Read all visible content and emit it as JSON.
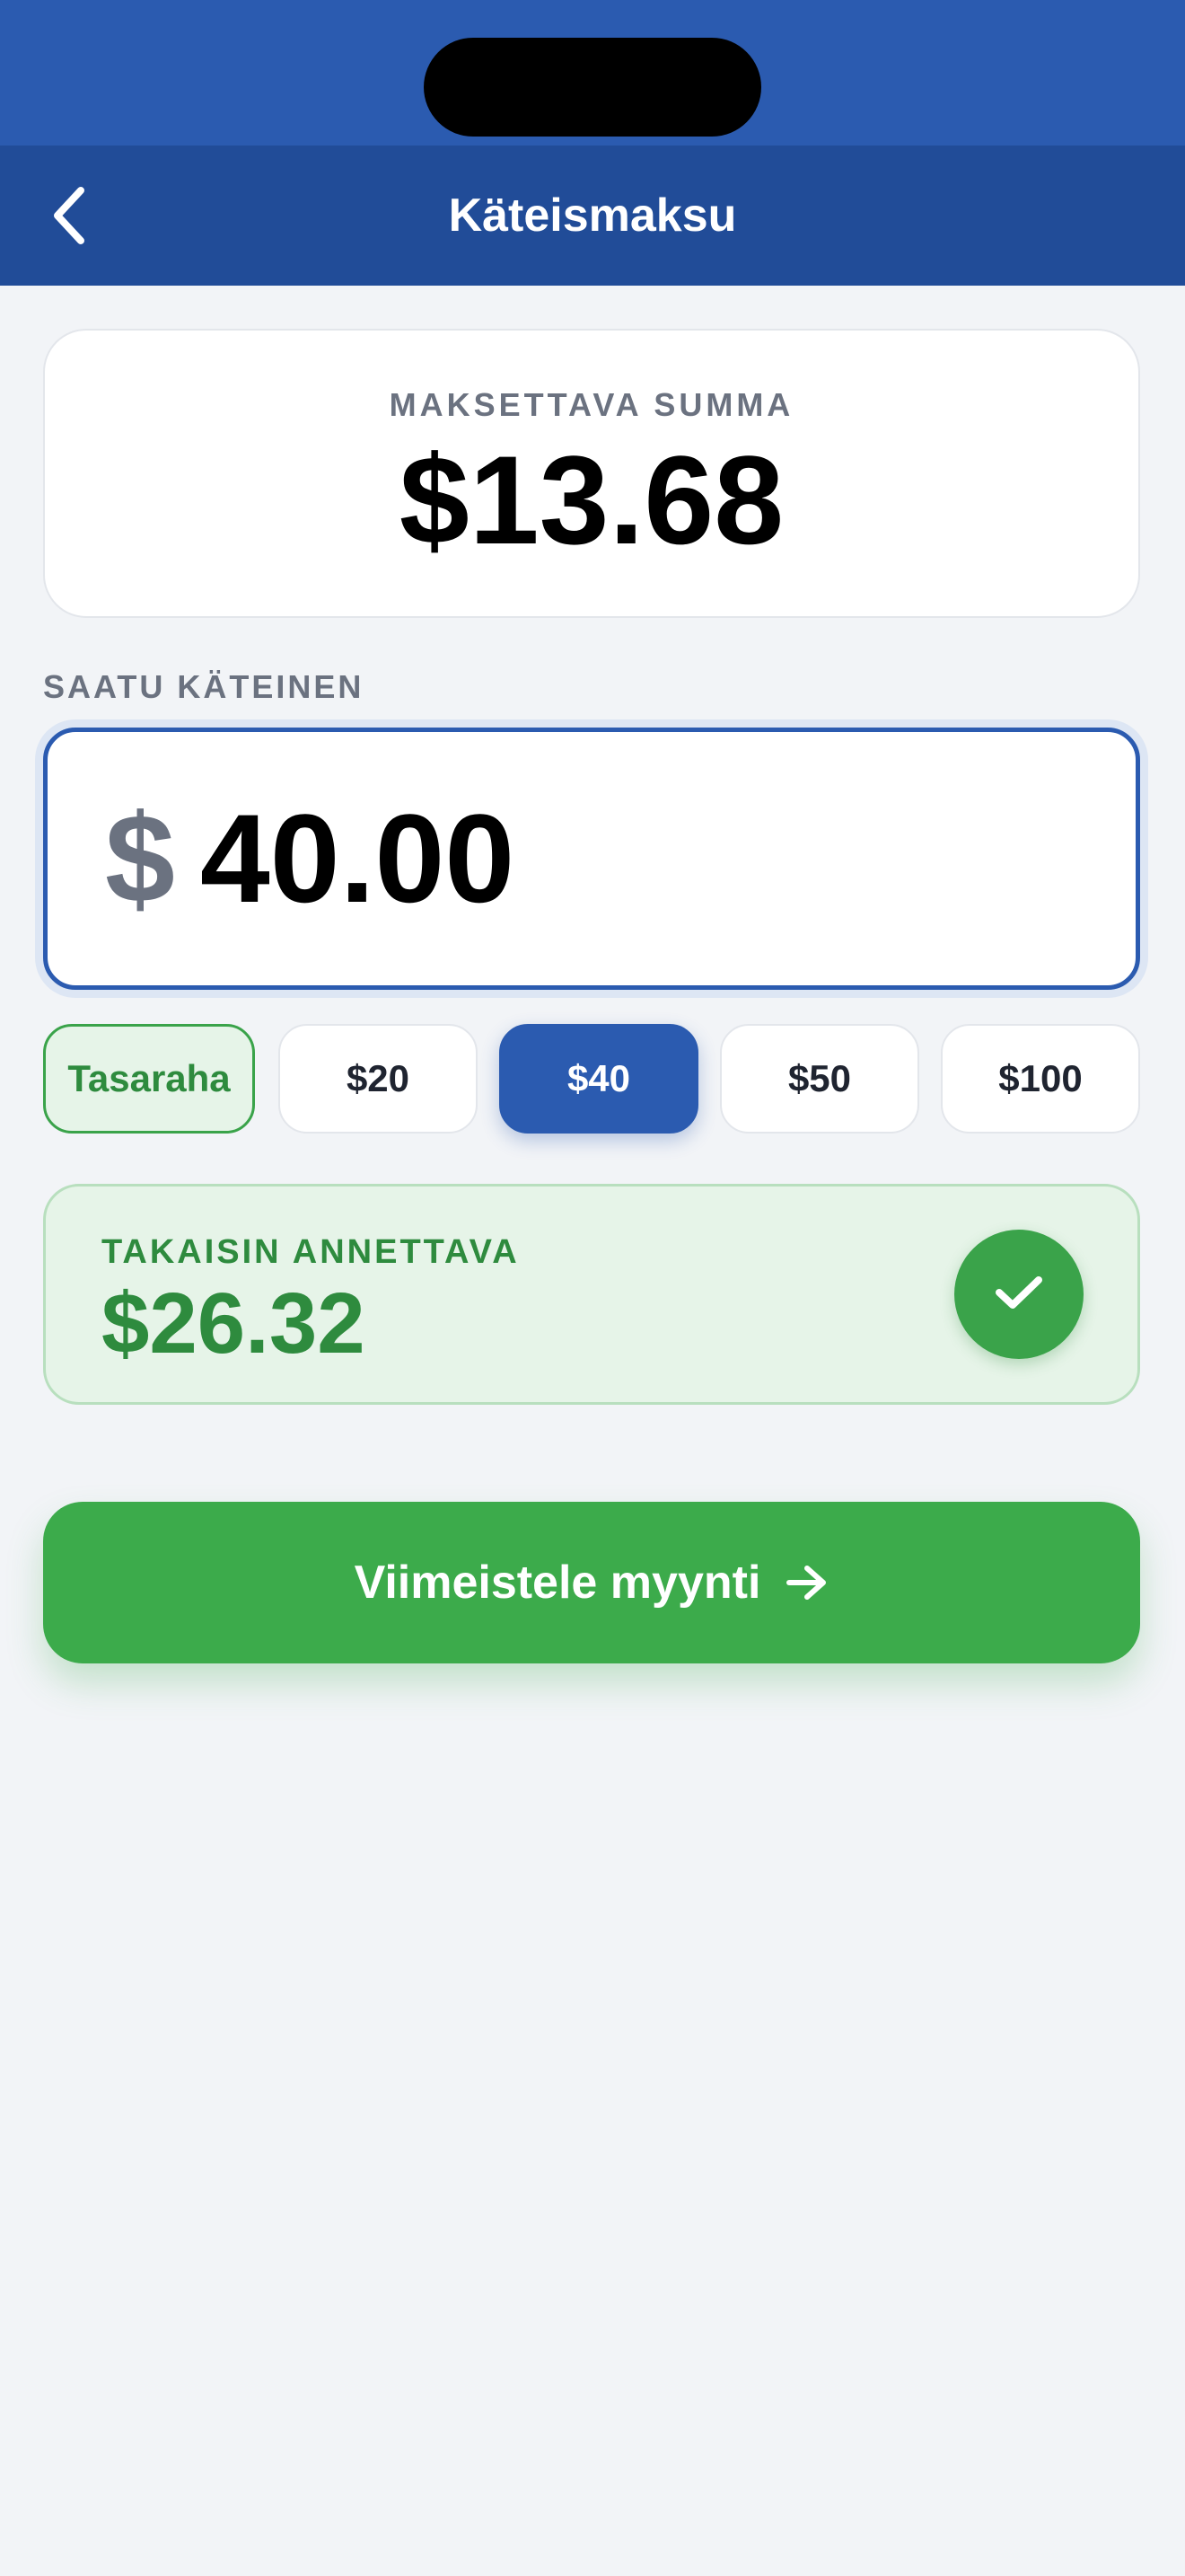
{
  "header": {
    "title": "Käteismaksu",
    "back_icon": "chevron-left-icon"
  },
  "amount_due": {
    "label": "MAKSETTAVA SUMMA",
    "value": "$13.68"
  },
  "cash_received": {
    "label": "SAATU KÄTEINEN",
    "currency_symbol": "$",
    "value": "40.00"
  },
  "quick_amounts": [
    {
      "label": "Tasaraha",
      "state": "exact"
    },
    {
      "label": "$20",
      "state": "default"
    },
    {
      "label": "$40",
      "state": "selected"
    },
    {
      "label": "$50",
      "state": "default"
    },
    {
      "label": "$100",
      "state": "default"
    }
  ],
  "change_due": {
    "label": "TAKAISIN ANNETTAVA",
    "value": "$26.32",
    "icon": "check-icon"
  },
  "finish_button": {
    "label": "Viimeistele myynti",
    "icon": "arrow-right-icon"
  },
  "colors": {
    "primary_blue": "#2b5bb0",
    "nav_blue": "#214c98",
    "success_green": "#3aa34a",
    "success_text": "#2e8b3e",
    "success_bg": "#e6f4e8",
    "muted_text": "#6b7280",
    "page_bg": "#f2f4f7"
  }
}
